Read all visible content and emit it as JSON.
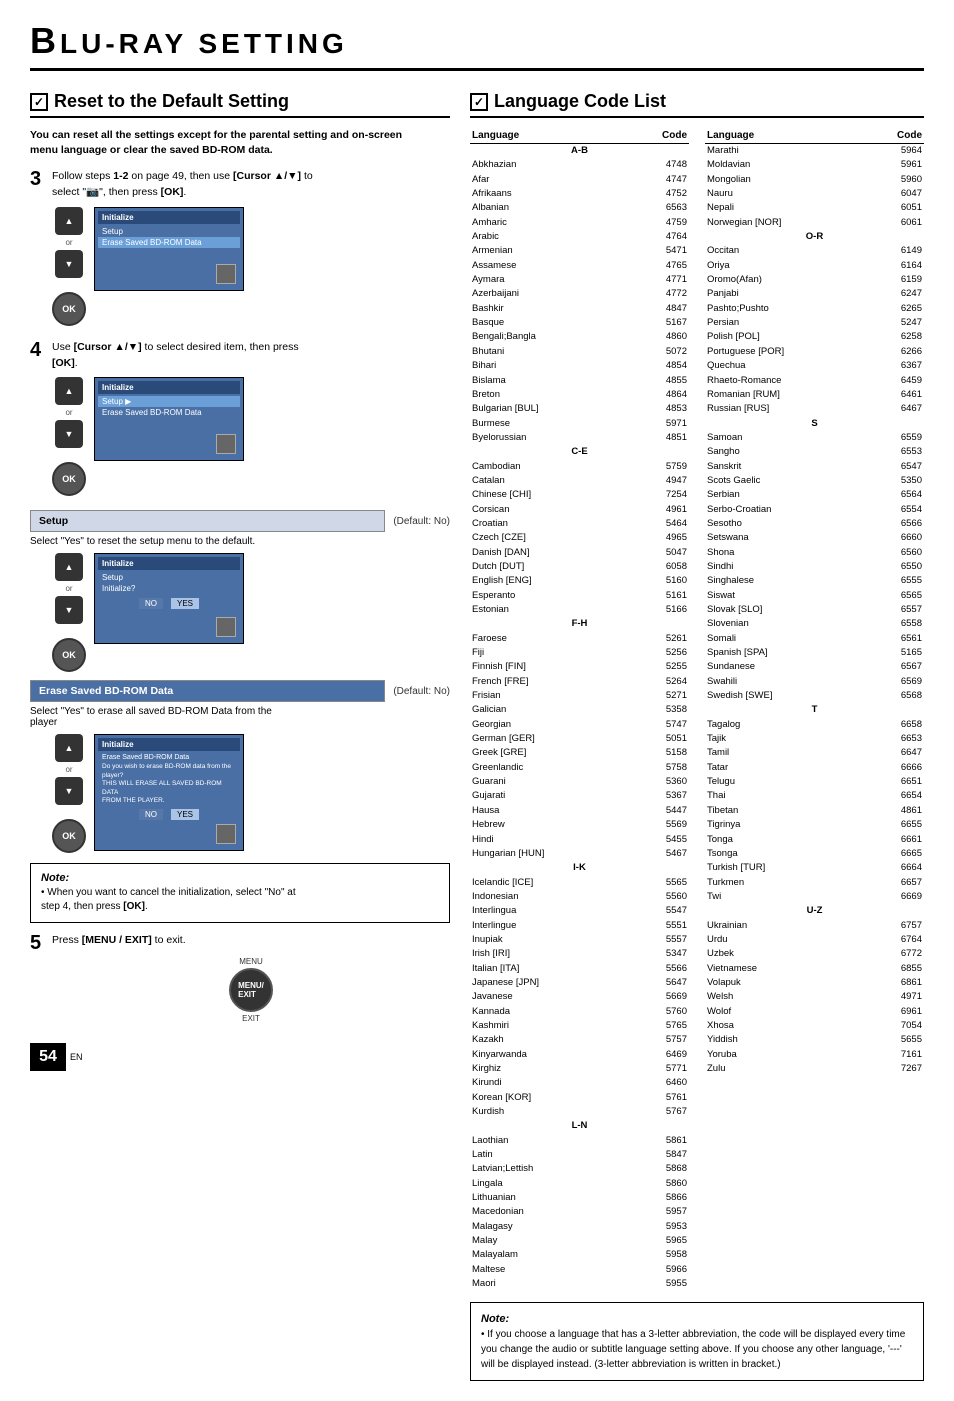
{
  "header": {
    "title": "LU-RAY   SETTING",
    "title_b": "B"
  },
  "left_section": {
    "heading": "Reset to the Default Setting",
    "description": "You can reset all the settings except for the parental setting and on-screen\nmenu language or clear the saved BD-ROM data.",
    "step3": {
      "number": "3",
      "text": "Follow steps 1-2 on page 49, then use [Cursor ▲/▼] to\nselect \"",
      "text2": "\", then press [OK]."
    },
    "step4": {
      "number": "4",
      "text": "Use [Cursor ▲/▼] to select desired item, then press\n[OK]."
    },
    "setup_box": {
      "label": "Setup",
      "default": "(Default: No)"
    },
    "setup_description": "Select \"Yes\" to reset the setup menu to the default.",
    "erase_box": {
      "label": "Erase Saved BD-ROM Data",
      "default": "(Default: No)"
    },
    "erase_description": "Select \"Yes\" to erase all saved BD-ROM Data from the\nplayer",
    "note": {
      "title": "Note:",
      "bullet": "When you want to cancel the initialization, select \"No\" at\nstep 4, then press [OK]."
    },
    "step5": {
      "number": "5",
      "text": "Press [MENU / EXIT] to exit."
    },
    "menu_label": "MENU",
    "exit_label": "EXIT"
  },
  "right_section": {
    "heading": "Language Code List",
    "col1": {
      "section_ab": "A-B",
      "rows": [
        {
          "lang": "Abkhazian",
          "code": "4748"
        },
        {
          "lang": "Afar",
          "code": "4747"
        },
        {
          "lang": "Afrikaans",
          "code": "4752"
        },
        {
          "lang": "Albanian",
          "code": "6563"
        },
        {
          "lang": "Amharic",
          "code": "4759"
        },
        {
          "lang": "Arabic",
          "code": "4764"
        },
        {
          "lang": "Armenian",
          "code": "5471"
        },
        {
          "lang": "Assamese",
          "code": "4765"
        },
        {
          "lang": "Aymara",
          "code": "4771"
        },
        {
          "lang": "Azerbaijani",
          "code": "4772"
        },
        {
          "lang": "Bashkir",
          "code": "4847"
        },
        {
          "lang": "Basque",
          "code": "5167"
        },
        {
          "lang": "Bengali;Bangla",
          "code": "4860"
        },
        {
          "lang": "Bhutani",
          "code": "5072"
        },
        {
          "lang": "Bihari",
          "code": "4854"
        },
        {
          "lang": "Bislama",
          "code": "4855"
        },
        {
          "lang": "Breton",
          "code": "4864"
        },
        {
          "lang": "Bulgarian [BUL]",
          "code": "4853"
        },
        {
          "lang": "Burmese",
          "code": "5971"
        },
        {
          "lang": "Byelorussian",
          "code": "4851"
        }
      ],
      "section_ce": "C-E",
      "rows_ce": [
        {
          "lang": "Cambodian",
          "code": "5759"
        },
        {
          "lang": "Catalan",
          "code": "4947"
        },
        {
          "lang": "Chinese [CHI]",
          "code": "7254"
        },
        {
          "lang": "Corsican",
          "code": "4961"
        },
        {
          "lang": "Croatian",
          "code": "5464"
        },
        {
          "lang": "Czech [CZE]",
          "code": "4965"
        },
        {
          "lang": "Danish [DAN]",
          "code": "5047"
        },
        {
          "lang": "Dutch [DUT]",
          "code": "6058"
        },
        {
          "lang": "English [ENG]",
          "code": "5160"
        },
        {
          "lang": "Esperanto",
          "code": "5161"
        },
        {
          "lang": "Estonian",
          "code": "5166"
        }
      ],
      "section_fh": "F-H",
      "rows_fh": [
        {
          "lang": "Faroese",
          "code": "5261"
        },
        {
          "lang": "Fiji",
          "code": "5256"
        },
        {
          "lang": "Finnish [FIN]",
          "code": "5255"
        },
        {
          "lang": "French [FRE]",
          "code": "5264"
        },
        {
          "lang": "Frisian",
          "code": "5271"
        },
        {
          "lang": "Galician",
          "code": "5358"
        },
        {
          "lang": "Georgian",
          "code": "5747"
        },
        {
          "lang": "German [GER]",
          "code": "5051"
        },
        {
          "lang": "Greek [GRE]",
          "code": "5158"
        },
        {
          "lang": "Greenlandic",
          "code": "5758"
        },
        {
          "lang": "Guarani",
          "code": "5360"
        },
        {
          "lang": "Gujarati",
          "code": "5367"
        },
        {
          "lang": "Hausa",
          "code": "5447"
        },
        {
          "lang": "Hebrew",
          "code": "5569"
        },
        {
          "lang": "Hindi",
          "code": "5455"
        },
        {
          "lang": "Hungarian [HUN]",
          "code": "5467"
        }
      ],
      "section_ik": "I-K",
      "rows_ik": [
        {
          "lang": "Icelandic [ICE]",
          "code": "5565"
        },
        {
          "lang": "Indonesian",
          "code": "5560"
        },
        {
          "lang": "Interlingua",
          "code": "5547"
        },
        {
          "lang": "Interlingue",
          "code": "5551"
        },
        {
          "lang": "Inupiak",
          "code": "5557"
        },
        {
          "lang": "Irish [IRI]",
          "code": "5347"
        },
        {
          "lang": "Italian [ITA]",
          "code": "5566"
        },
        {
          "lang": "Japanese [JPN]",
          "code": "5647"
        },
        {
          "lang": "Javanese",
          "code": "5669"
        },
        {
          "lang": "Kannada",
          "code": "5760"
        },
        {
          "lang": "Kashmiri",
          "code": "5765"
        },
        {
          "lang": "Kazakh",
          "code": "5757"
        },
        {
          "lang": "Kinyarwanda",
          "code": "6469"
        },
        {
          "lang": "Kirghiz",
          "code": "5771"
        },
        {
          "lang": "Kirundi",
          "code": "6460"
        },
        {
          "lang": "Korean [KOR]",
          "code": "5761"
        },
        {
          "lang": "Kurdish",
          "code": "5767"
        }
      ],
      "section_ln": "L-N",
      "rows_ln": [
        {
          "lang": "Laothian",
          "code": "5861"
        },
        {
          "lang": "Latin",
          "code": "5847"
        },
        {
          "lang": "Latvian;Lettish",
          "code": "5868"
        },
        {
          "lang": "Lingala",
          "code": "5860"
        },
        {
          "lang": "Lithuanian",
          "code": "5866"
        },
        {
          "lang": "Macedonian",
          "code": "5957"
        },
        {
          "lang": "Malagasy",
          "code": "5953"
        },
        {
          "lang": "Malay",
          "code": "5965"
        },
        {
          "lang": "Malayalam",
          "code": "5958"
        },
        {
          "lang": "Maltese",
          "code": "5966"
        },
        {
          "lang": "Maori",
          "code": "5955"
        }
      ]
    },
    "col2": {
      "rows_top": [
        {
          "lang": "Marathi",
          "code": "5964"
        },
        {
          "lang": "Moldavian",
          "code": "5961"
        },
        {
          "lang": "Mongolian",
          "code": "5960"
        },
        {
          "lang": "Nauru",
          "code": "6047"
        },
        {
          "lang": "Nepali",
          "code": "6051"
        },
        {
          "lang": "Norwegian [NOR]",
          "code": "6061"
        }
      ],
      "section_or": "O-R",
      "rows_or": [
        {
          "lang": "Occitan",
          "code": "6149"
        },
        {
          "lang": "Oriya",
          "code": "6164"
        },
        {
          "lang": "Oromo(Afan)",
          "code": "6159"
        },
        {
          "lang": "Panjabi",
          "code": "6247"
        },
        {
          "lang": "Pashto;Pushto",
          "code": "6265"
        },
        {
          "lang": "Persian",
          "code": "5247"
        },
        {
          "lang": "Polish [POL]",
          "code": "6258"
        },
        {
          "lang": "Portuguese [POR]",
          "code": "6266"
        },
        {
          "lang": "Quechua",
          "code": "6367"
        },
        {
          "lang": "Rhaeto-Romance",
          "code": "6459"
        },
        {
          "lang": "Romanian [RUM]",
          "code": "6461"
        },
        {
          "lang": "Russian [RUS]",
          "code": "6467"
        }
      ],
      "section_s": "S",
      "rows_s": [
        {
          "lang": "Samoan",
          "code": "6559"
        },
        {
          "lang": "Sangho",
          "code": "6553"
        },
        {
          "lang": "Sanskrit",
          "code": "6547"
        },
        {
          "lang": "Scots Gaelic",
          "code": "5350"
        },
        {
          "lang": "Serbian",
          "code": "6564"
        },
        {
          "lang": "Serbo-Croatian",
          "code": "6554"
        },
        {
          "lang": "Sesotho",
          "code": "6566"
        },
        {
          "lang": "Setswana",
          "code": "6660"
        },
        {
          "lang": "Shona",
          "code": "6560"
        },
        {
          "lang": "Sindhi",
          "code": "6550"
        },
        {
          "lang": "Singhalese",
          "code": "6555"
        },
        {
          "lang": "Siswat",
          "code": "6565"
        },
        {
          "lang": "Slovak [SLO]",
          "code": "6557"
        },
        {
          "lang": "Slovenian",
          "code": "6558"
        },
        {
          "lang": "Somali",
          "code": "6561"
        },
        {
          "lang": "Spanish [SPA]",
          "code": "5165"
        },
        {
          "lang": "Sundanese",
          "code": "6567"
        },
        {
          "lang": "Swahili",
          "code": "6569"
        },
        {
          "lang": "Swedish [SWE]",
          "code": "6568"
        }
      ],
      "section_t": "T",
      "rows_t": [
        {
          "lang": "Tagalog",
          "code": "6658"
        },
        {
          "lang": "Tajik",
          "code": "6653"
        },
        {
          "lang": "Tamil",
          "code": "6647"
        },
        {
          "lang": "Tatar",
          "code": "6666"
        },
        {
          "lang": "Telugu",
          "code": "6651"
        },
        {
          "lang": "Thai",
          "code": "6654"
        },
        {
          "lang": "Tibetan",
          "code": "4861"
        },
        {
          "lang": "Tigrinya",
          "code": "6655"
        },
        {
          "lang": "Tonga",
          "code": "6661"
        },
        {
          "lang": "Tsonga",
          "code": "6665"
        },
        {
          "lang": "Turkish [TUR]",
          "code": "6664"
        },
        {
          "lang": "Turkmen",
          "code": "6657"
        },
        {
          "lang": "Twi",
          "code": "6669"
        }
      ],
      "section_uz": "U-Z",
      "rows_uz": [
        {
          "lang": "Ukrainian",
          "code": "6757"
        },
        {
          "lang": "Urdu",
          "code": "6764"
        },
        {
          "lang": "Uzbek",
          "code": "6772"
        },
        {
          "lang": "Vietnamese",
          "code": "6855"
        },
        {
          "lang": "Volapuk",
          "code": "6861"
        },
        {
          "lang": "Welsh",
          "code": "4971"
        },
        {
          "lang": "Wolof",
          "code": "6961"
        },
        {
          "lang": "Xhosa",
          "code": "7054"
        },
        {
          "lang": "Yiddish",
          "code": "5655"
        },
        {
          "lang": "Yoruba",
          "code": "7161"
        },
        {
          "lang": "Zulu",
          "code": "7267"
        }
      ]
    },
    "note": {
      "title": "Note:",
      "text": "• If you choose a language that has a 3-letter abbreviation, the code will be displayed every time you change the audio or subtitle language setting above. If you choose any other language, '---' will be displayed instead. (3-letter abbreviation is written in bracket.)"
    }
  },
  "page_number": "54",
  "page_sub": "EN",
  "screens": {
    "screen1": {
      "title": "Initialize",
      "items": [
        "Setup",
        "Erase Saved BD-ROM Data"
      ]
    },
    "screen2": {
      "title": "Initialize",
      "items": [
        "Setup ▶",
        "Erase Saved BD-ROM Data"
      ]
    },
    "screen3": {
      "title": "Initialize",
      "subtitle": "Setup",
      "sub2": "Initialize?",
      "no": "NO",
      "yes": "YES"
    },
    "screen4": {
      "title": "Initialize",
      "subtitle": "Erase Saved BD-ROM Data",
      "desc": "Do you wish to erase BD-ROM data from the player?\nTHIS WILL ERASE ALL SAVED BD-ROM DATA\nFROM THE PLAYER.",
      "no": "NO",
      "yes": "YES"
    }
  }
}
